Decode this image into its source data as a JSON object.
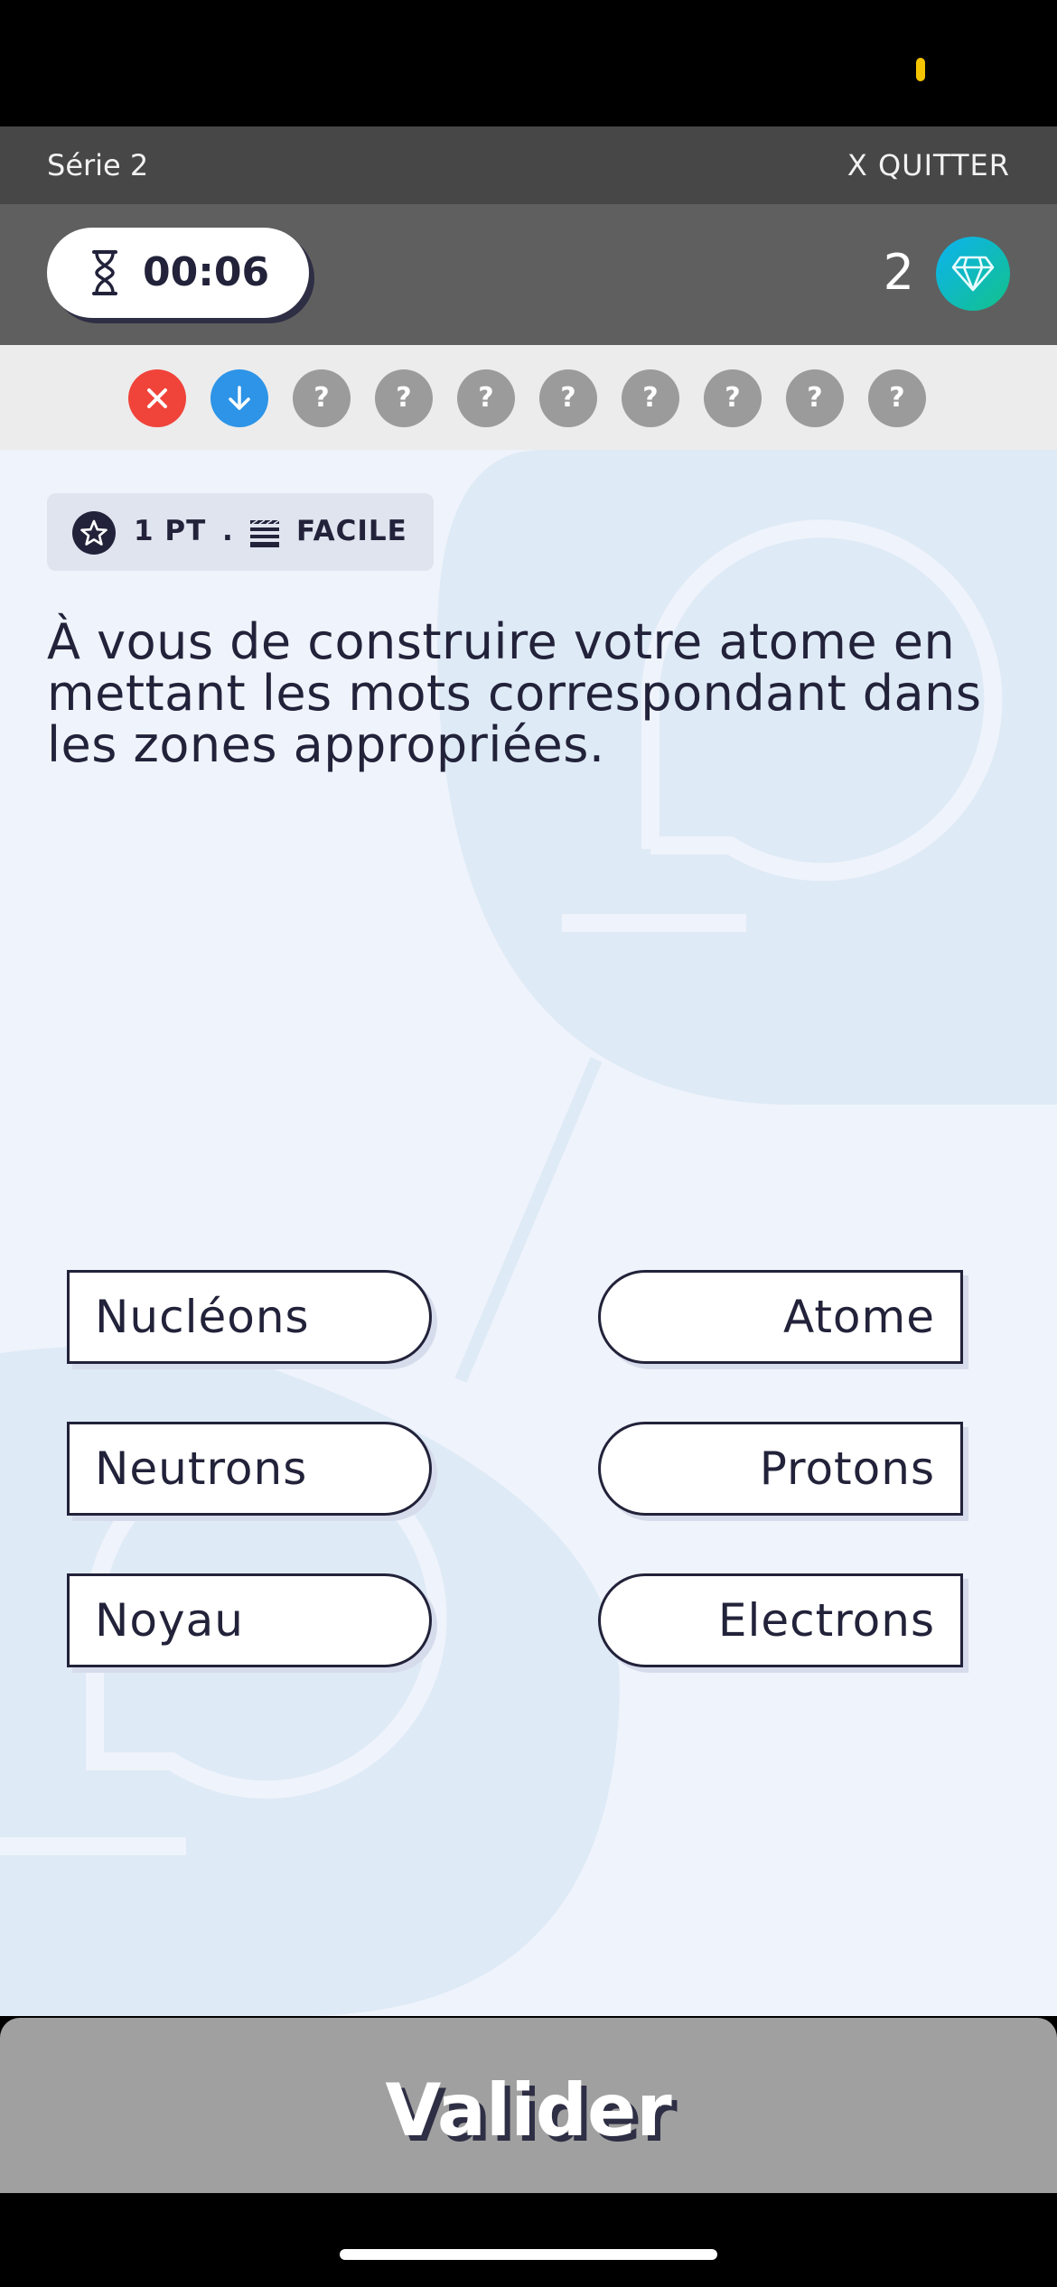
{
  "header": {
    "series_title": "Série 2",
    "quit_label": "X QUITTER",
    "timer": "00:06",
    "gem_count": "2"
  },
  "progress": {
    "items": [
      {
        "state": "wrong",
        "label": ""
      },
      {
        "state": "current",
        "label": ""
      },
      {
        "state": "pending",
        "label": "?"
      },
      {
        "state": "pending",
        "label": "?"
      },
      {
        "state": "pending",
        "label": "?"
      },
      {
        "state": "pending",
        "label": "?"
      },
      {
        "state": "pending",
        "label": "?"
      },
      {
        "state": "pending",
        "label": "?"
      },
      {
        "state": "pending",
        "label": "?"
      },
      {
        "state": "pending",
        "label": "?"
      }
    ]
  },
  "question": {
    "points": "1 PT",
    "separator": ".",
    "difficulty": "FACILE",
    "text": "À vous de construire votre atome en mettant les mots correspondant dans les zones appropriées."
  },
  "words": {
    "left": [
      "Nucléons",
      "Neutrons",
      "Noyau"
    ],
    "right": [
      "Atome",
      "Protons",
      "Electrons"
    ]
  },
  "footer": {
    "validate_label": "Valider"
  },
  "colors": {
    "wrong": "#f0433a",
    "current": "#2d94e7",
    "pending": "#9b9b9b",
    "ink": "#22223a",
    "background": "#eff3fb"
  },
  "icons": {
    "timer": "hourglass-icon",
    "gems": "diamond-icon",
    "points": "star-icon",
    "difficulty": "striped-bars-icon"
  }
}
